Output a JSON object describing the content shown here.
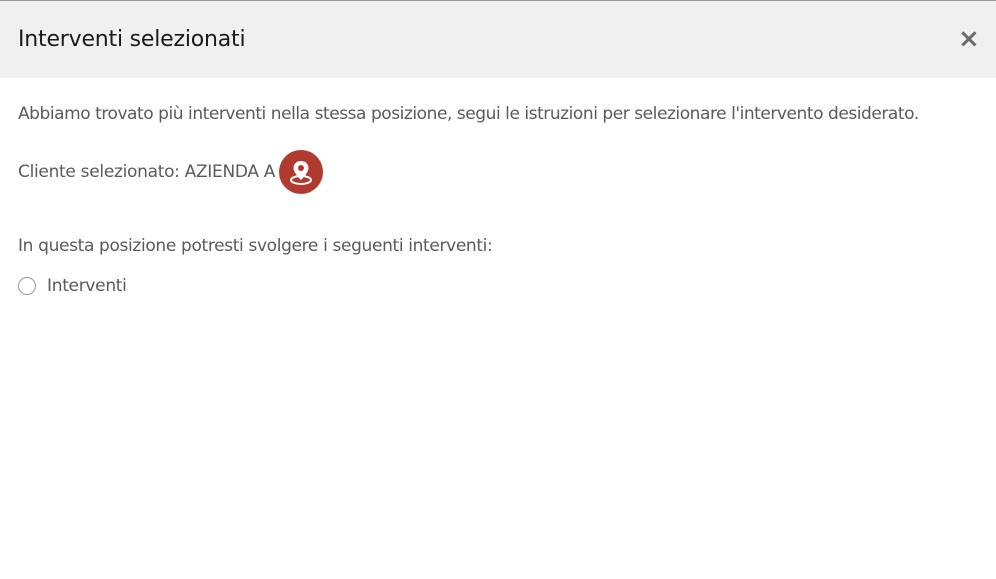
{
  "dialog": {
    "title": "Interventi selezionati",
    "close_label": "×"
  },
  "body": {
    "intro": "Abbiamo trovato più interventi nella stessa posizione, segui le istruzioni per selezionare l'intervento desiderato.",
    "client_label": "Cliente selezionato:",
    "client_name": "AZIENDA A",
    "map_icon": "map-pin-icon",
    "subheading": "In questa posizione potresti svolgere i seguenti interventi:",
    "options": [
      {
        "label": "Interventi",
        "selected": false
      }
    ]
  },
  "colors": {
    "accent": "#b03a2e",
    "header_bg": "#f0f0f0",
    "text": "#5a5a5a"
  }
}
